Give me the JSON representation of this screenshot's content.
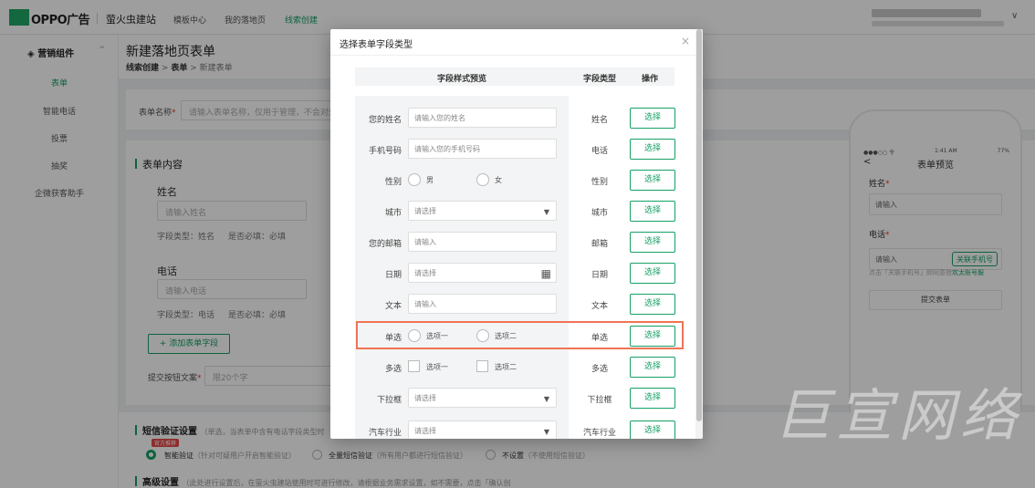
{
  "topbar": {
    "brand": "OPPO广告",
    "site": "萤火虫建站",
    "nav": [
      "模板中心",
      "我的落地页",
      "线索创建"
    ]
  },
  "sidebar": {
    "header": "营销组件",
    "items": [
      "表单",
      "智能电话",
      "投票",
      "抽奖",
      "企微获客助手"
    ]
  },
  "page": {
    "title": "新建落地页表单",
    "crumbs": [
      "线索创建",
      "表单",
      "新建表单"
    ],
    "crumb_sep": ">"
  },
  "form": {
    "name_label": "表单名称",
    "name_placeholder": "请输入表单名称，仅用于管理，不会对外",
    "section_title": "表单内容",
    "fields": [
      {
        "name": "姓名",
        "placeholder": "请输入姓名",
        "meta_type": "字段类型：姓名",
        "meta_req": "是否必填：必填"
      },
      {
        "name": "电话",
        "placeholder": "请输入电话",
        "meta_type": "字段类型：电话",
        "meta_req": "是否必填：必填"
      }
    ],
    "add_button": "+ 添加表单字段",
    "submit_label": "提交按钮文案",
    "submit_placeholder": "限20个字"
  },
  "sms": {
    "title": "短信验证设置",
    "subtitle": "（单选，当表单中含有电话字段类型时",
    "badge": "官方推荐",
    "options": [
      {
        "label": "智能验证",
        "note": "（针对可疑用户开启智能验证）"
      },
      {
        "label": "全量短信验证",
        "note": "（所有用户都进行短信验证）"
      },
      {
        "label": "不设置",
        "note": "（不使用短信验证）"
      }
    ]
  },
  "advanced": {
    "title": "高级设置",
    "subtitle": "（此处进行设置后，在萤火虫建站使用时可进行修改，请根据业务需求设置，如不需要，点击「确认创"
  },
  "preview": {
    "status_left": "●●●○○ 令",
    "status_time": "1:41 AM",
    "status_right": "77%",
    "back": "<",
    "title": "表单预览",
    "fields": [
      {
        "label": "姓名",
        "placeholder": "请输入"
      },
      {
        "label": "电话",
        "placeholder": "请输入"
      }
    ],
    "bind_button": "关联手机号",
    "hint_pre": "点击「关联手机号」即同意授",
    "hint_link": "欢太账号服",
    "submit": "提交表单"
  },
  "watermark": "巨宣网络",
  "modal": {
    "title": "选择表单字段类型",
    "close": "×",
    "headers": [
      "字段样式预览",
      "字段类型",
      "操作"
    ],
    "rows": [
      {
        "label": "您的姓名",
        "kind": "input",
        "placeholder": "请输入您的姓名",
        "type": "姓名"
      },
      {
        "label": "手机号码",
        "kind": "input",
        "placeholder": "请输入您的手机号码",
        "type": "电话"
      },
      {
        "label": "性别",
        "kind": "radio",
        "options": [
          "男",
          "女"
        ],
        "type": "性别"
      },
      {
        "label": "城市",
        "kind": "select",
        "placeholder": "请选择",
        "type": "城市"
      },
      {
        "label": "您的邮箱",
        "kind": "input",
        "placeholder": "请输入",
        "type": "邮箱"
      },
      {
        "label": "日期",
        "kind": "date",
        "placeholder": "请选择",
        "type": "日期"
      },
      {
        "label": "文本",
        "kind": "input",
        "placeholder": "请输入",
        "type": "文本"
      },
      {
        "label": "单选",
        "kind": "radio",
        "options": [
          "选项一",
          "选项二"
        ],
        "type": "单选"
      },
      {
        "label": "多选",
        "kind": "checkbox",
        "options": [
          "选项一",
          "选项二"
        ],
        "type": "多选"
      },
      {
        "label": "下拉框",
        "kind": "select",
        "placeholder": "请选择",
        "type": "下拉框"
      },
      {
        "label": "汽车行业",
        "kind": "select",
        "placeholder": "请选择",
        "type": "汽车行业"
      }
    ],
    "select_label": "选择"
  },
  "colors": {
    "accent": "#16a065",
    "highlight": "#f07355",
    "badge": "#e64a4a"
  }
}
